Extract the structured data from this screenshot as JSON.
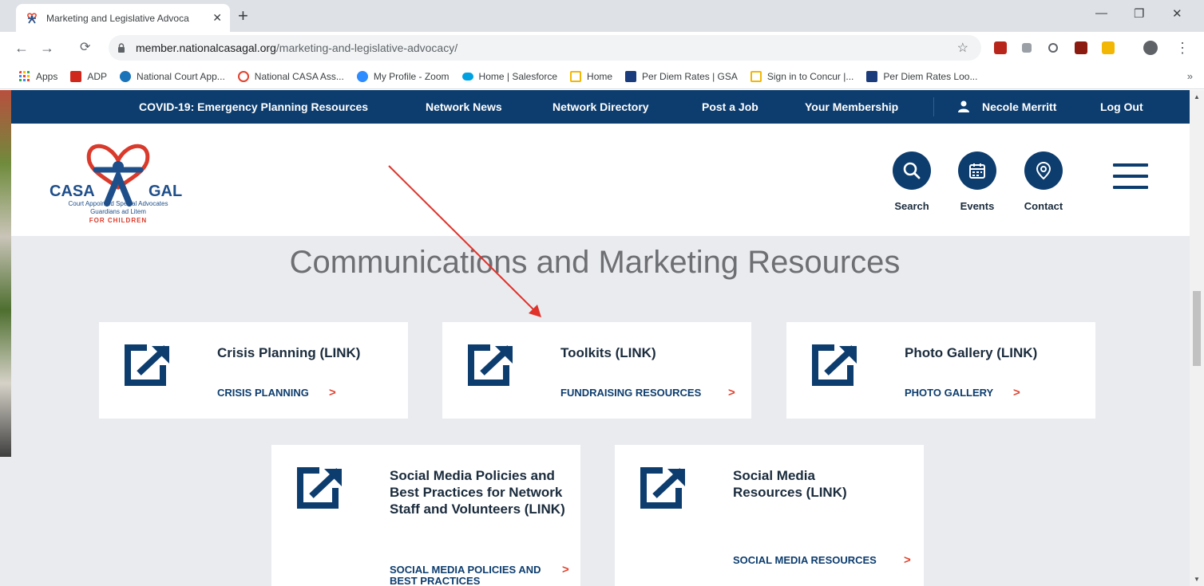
{
  "browser": {
    "tab_title": "Marketing and Legislative Advoca",
    "url_domain": "member.nationalcasagal.org",
    "url_path": "/marketing-and-legislative-advocacy/"
  },
  "bookmarks": [
    {
      "label": "Apps",
      "color": "#4285f4"
    },
    {
      "label": "ADP",
      "color": "#d0271d"
    },
    {
      "label": "National Court App...",
      "color": "#1a73b8"
    },
    {
      "label": "National CASA Ass...",
      "color": "#e0432f"
    },
    {
      "label": "My Profile - Zoom",
      "color": "#2d8cff"
    },
    {
      "label": "Home | Salesforce",
      "color": "#00a1e0"
    },
    {
      "label": "Home",
      "color": "#f2b705"
    },
    {
      "label": "Per Diem Rates | GSA",
      "color": "#1b3c7c"
    },
    {
      "label": "Sign in to Concur |...",
      "color": "#f2b705"
    },
    {
      "label": "Per Diem Rates Loo...",
      "color": "#1b3c7c"
    }
  ],
  "topnav": [
    "COVID-19: Emergency Planning Resources",
    "Network News",
    "Network Directory",
    "Post a Job",
    "Your Membership",
    "Necole Merritt",
    "Log Out"
  ],
  "logo": {
    "sub1": "Court Appointed Special Advocates",
    "sub2": "Guardians ad Litem",
    "sub3": "FOR CHILDREN"
  },
  "header_icons": {
    "search": "Search",
    "events": "Events",
    "contact": "Contact"
  },
  "section_title": "Communications and Marketing Resources",
  "cards": [
    {
      "title": "Crisis Planning (LINK)",
      "link": "CRISIS PLANNING"
    },
    {
      "title": "Toolkits (LINK)",
      "link": "FUNDRAISING RESOURCES"
    },
    {
      "title": "Photo Gallery (LINK)",
      "link": "PHOTO GALLERY"
    },
    {
      "title": "Social Media Policies and Best Practices for Network Staff and Volunteers (LINK)",
      "link": "SOCIAL MEDIA POLICIES AND BEST PRACTICES"
    },
    {
      "title": "Social Media Resources (LINK)",
      "link": "SOCIAL MEDIA RESOURCES"
    }
  ],
  "colors": {
    "nav_blue": "#0d3d6e",
    "accent_red": "#e0432f",
    "page_bg": "#e9ebef"
  }
}
